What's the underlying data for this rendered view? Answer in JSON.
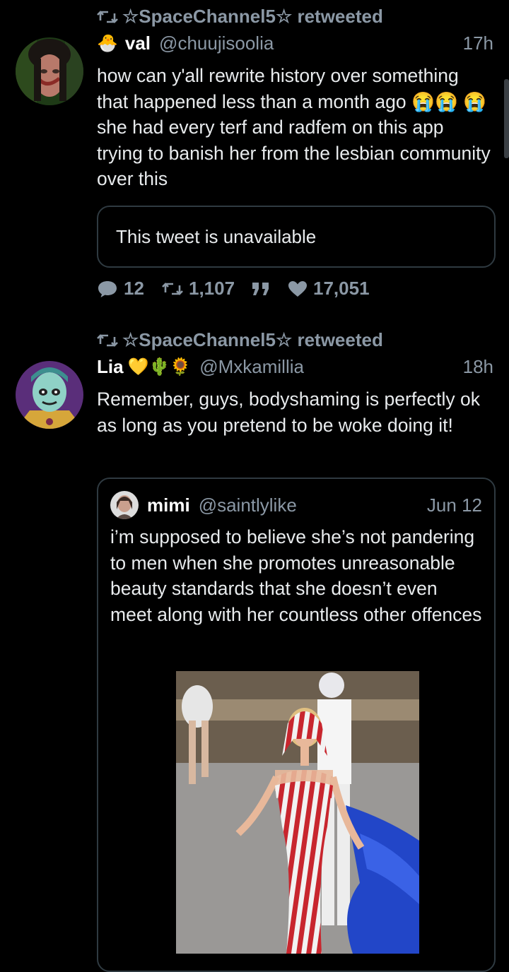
{
  "tweets": [
    {
      "retweeted_by": "☆SpaceChannel5☆ retweeted",
      "name_prefix_emoji": "🐣",
      "name": "val",
      "handle": "@chuujisoolia",
      "time": "17h",
      "text": "how can y'all rewrite history over something that happened less than a month ago 😭😭 😭 she had every terf and radfem on this app trying to banish her from the lesbian community over this",
      "embedded_card": "This tweet is unavailable",
      "replies": "12",
      "retweets": "1,107",
      "quote_icon": "quote-icon",
      "likes": "17,051"
    },
    {
      "retweeted_by": "☆SpaceChannel5☆ retweeted",
      "name": "Lia",
      "name_emojis": "💛🌵🌻",
      "handle": "@Mxkamillia",
      "time": "18h",
      "text": "Remember, guys, bodyshaming is perfectly ok as long as you pretend to be woke doing it!",
      "quoted": {
        "name": "mimi",
        "handle": "@saintlylike",
        "time": "Jun 12",
        "text": "i’m supposed to believe she’s not pandering to men when she promotes unreasonable beauty standards that she doesn’t even meet along with her countless other offences"
      }
    }
  ],
  "colors": {
    "background": "#000000",
    "muted": "#8b98a5",
    "text": "#e8ebed",
    "border": "#2f3a41"
  }
}
